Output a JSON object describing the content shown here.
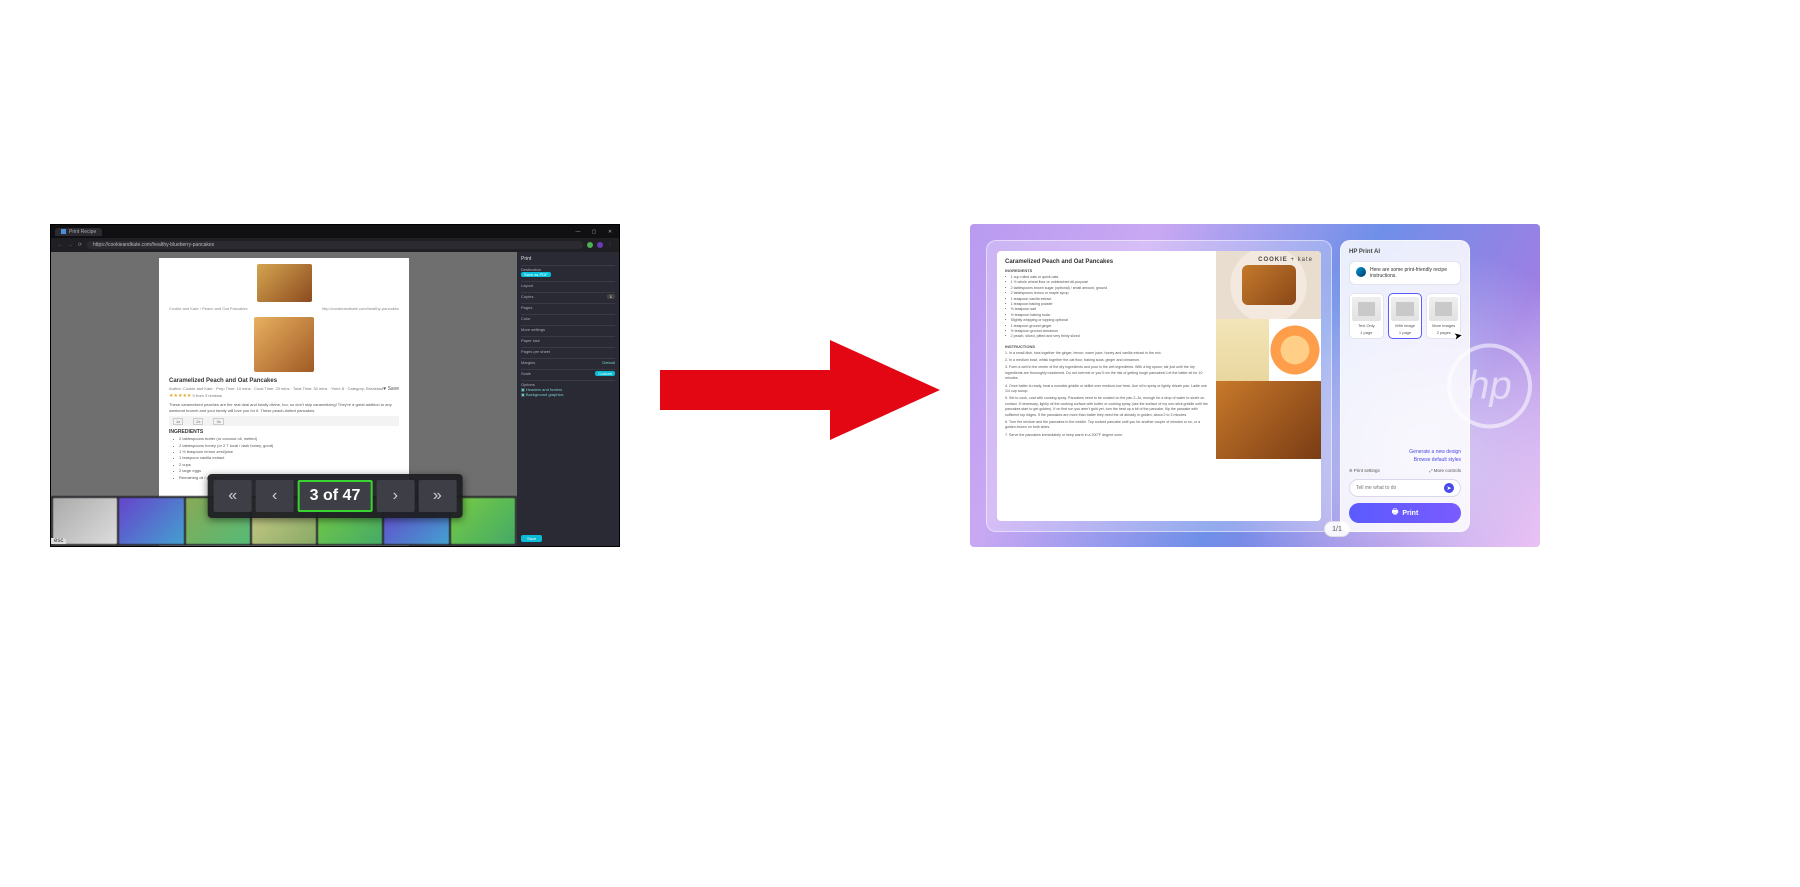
{
  "left": {
    "tab_title": "Print Recipe",
    "win_controls": {
      "min": "—",
      "max": "▢",
      "close": "✕"
    },
    "url": "https://cookieandkate.com/healthy-blueberry-pancakes",
    "page": {
      "crumb_left": "Cookie and Kate › Peach and Oat Pancakes",
      "crumb_right": "http://cookieandkate.com/healthy-pancakes",
      "title": "Caramelized Peach and Oat Pancakes",
      "byline": "Author: Cookie and Kate · Prep Time: 10 mins · Cook Time: 20 mins · Total Time: 30 mins · Yield: 8 · Category: Breakfast",
      "stars_label": "5 from 3 reviews",
      "heart": "♥ Save",
      "description": "These caramelized peaches are the real deal and totally divine, too, so don't skip caramelizing! They're a great addition to any weekend brunch and your family will love you for it. These peach-dotted pancakes.",
      "section_ingredients": "INGREDIENTS",
      "ingredients": [
        "2 tablespoons butter (or coconut oil, melted)",
        "2 tablespoons honey (or 2 T local / dark honey, good)",
        "1 ½ teaspoon lemon zest/juice",
        "1 teaspoon vanilla extract",
        "2 cups",
        "2 large eggs",
        "Remaining oil / process"
      ]
    },
    "paginator": {
      "first": "«",
      "prev": "‹",
      "label": "3 of 47",
      "next": "›",
      "last": "»"
    },
    "panel": {
      "header": "Print",
      "dest_label": "Destination",
      "dest_chip": "Save as PDF",
      "layout": "Layout",
      "copies": "Copies",
      "copies_val": "1",
      "pages": "Pages",
      "color": "Color",
      "more_label": "More settings",
      "paper": "Paper size",
      "pages_per": "Pages per sheet",
      "margins": "Margins",
      "default": "Default",
      "scale": "Scale",
      "scale_chip": "Custom",
      "options": "Options",
      "opt1": "Headers and footers",
      "opt2": "Background graphics",
      "save": "Save"
    },
    "corner_label": "esc"
  },
  "right": {
    "brand1": "COOKIE",
    "brand2": "+ kate",
    "doc": {
      "title": "Caramelized Peach and Oat Pancakes",
      "ing_label": "INGREDIENTS",
      "ingredients": [
        "1 cup rolled oats or quick oats",
        "1 ½ whole wheat flour or unbleached all-purpose",
        "2 tablespoons brown sugar (optional) / small amount, ground",
        "2 tablespoons lemon or maple syrup",
        "1 teaspoon vanilla extract",
        "1 teaspoon baking powder",
        "½ teaspoon salt",
        "½ teaspoon baking soda",
        "Slightly whipping or topping optional",
        "1 teaspoon ground ginger",
        "½ teaspoon ground cinnamon",
        "2 peach, sliced, pitted and very thinly sliced"
      ],
      "instr_label": "INSTRUCTIONS",
      "instructions": [
        "In a small dish, toss together the ginger, lemon, warm juice, honey and vanilla extract in the mix.",
        "In a medium bowl, whisk together the oat flour, baking soda, ginger and cinnamon.",
        "Form a well in the center of the dry ingredients and pour in the wet ingredients. With a big spoon, stir just until the dry ingredients are thoroughly moistened. Do not overmix or you'll run the risk of getting tough pancakes! Let the batter sit for 10 minutes.",
        "Once batter is ready, heat a nonstick griddle or skillet over medium-low heat. Use oil to spray or lightly drizzle pan. Ladle one 1/4 cup scoop.",
        "Set to cook, coat with cooking spray. Pancakes need to be cooked on the pan 2–3x, enough for a drop of water to sizzle on contact. If necessary, lightly oil the cooking surface with butter or cooking spray (use the surface of my non-stick griddle until the pancakes start to get golden). If on first run you aren't gold yet, turn the heat up a bit of the pancake, flip the pancake with sufficient top ridges. If the pancakes are more than batter they need the oil already in golden, about 2 to 3 minutes.",
        "Turn the mixture and the pancakes to the middle. Top cooked pancake until you for another couple of minutes or so, or a golden-brown on both sides.",
        "Serve the pancakes immediately or keep warm in a 200°F degree oven."
      ]
    },
    "page_label": "1/1",
    "ai": {
      "header": "HP Print AI",
      "bubble": "Here are some print-friendly recipe instructions.",
      "cards": [
        {
          "line1": "Text Only",
          "line2": "1 page"
        },
        {
          "line1": "With image",
          "line2": "1 page"
        },
        {
          "line1": "More images",
          "line2": "2 pages"
        }
      ],
      "link1": "Generate a new design",
      "link2": "Browse default styles",
      "settings": "Print settings",
      "more": "More controls",
      "prompt_placeholder": "Tell me what to do",
      "print": "Print"
    },
    "hp_text": "hp"
  }
}
